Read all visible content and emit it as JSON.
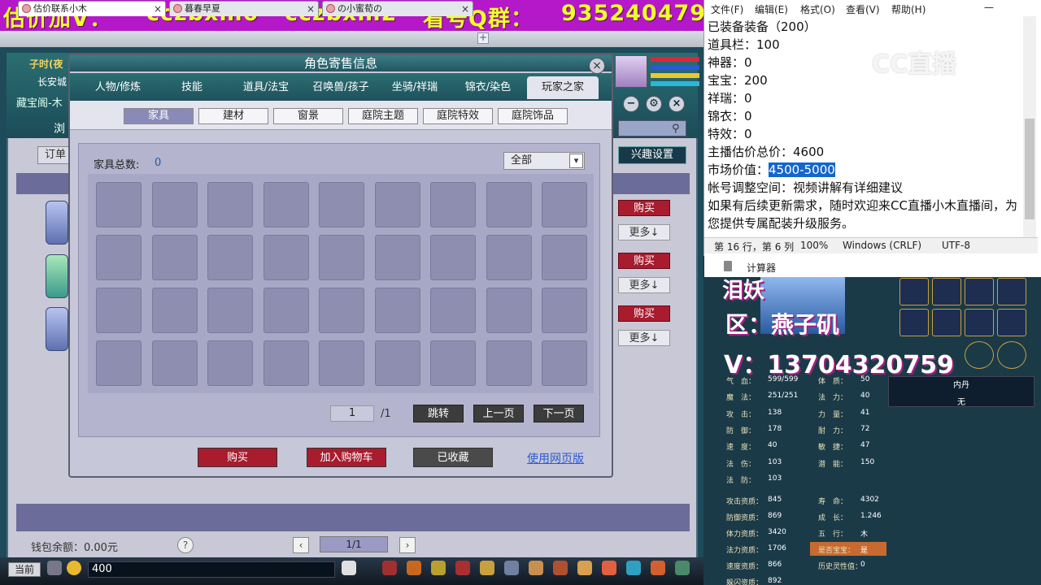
{
  "banner": {
    "a": "估价加V：",
    "b": "cczbxm0",
    "c": "cczbxm2",
    "d": "看号Q群：",
    "e": "935240479"
  },
  "browser_tabs": [
    "估价联系小木",
    "暮春早夏",
    "の小蜜荀の"
  ],
  "game": {
    "location_time": "子时(夜",
    "location_city": "长安城",
    "left_header": "藏宝阁-木",
    "left_browse": "浏",
    "order_label": "订单",
    "interest_button": "兴趣设置",
    "wallet": "钱包余额：0.00元",
    "help": "?",
    "page_indicator": "1/1",
    "chat_input": "400",
    "current_button": "当前",
    "outer_buy": "购买",
    "outer_more": "更多↓"
  },
  "dialog": {
    "title": "角色寄售信息",
    "close": "×",
    "tabs": [
      "人物/修炼",
      "技能",
      "道具/法宝",
      "召唤兽/孩子",
      "坐骑/祥瑞",
      "锦衣/染色",
      "玩家之家"
    ],
    "active_tab": 6,
    "subtabs": [
      "家具",
      "建材",
      "窗景",
      "庭院主题",
      "庭院特效",
      "庭院饰品"
    ],
    "active_subtab": 0,
    "count_label": "家具总数:",
    "count_value": "0",
    "filter": "全部",
    "page_input": "1",
    "page_total": "/1",
    "jump": "跳转",
    "prev": "上一页",
    "next": "下一页",
    "buy": "购买",
    "add_cart": "加入购物车",
    "favorited": "已收藏",
    "web_link": "使用网页版"
  },
  "notepad": {
    "menu": [
      "文件(F)",
      "编辑(E)",
      "格式(O)",
      "查看(V)",
      "帮助(H)"
    ],
    "lines": [
      "已装备装备（200）",
      "道具栏：100",
      "神器：0",
      "宝宝：200",
      "祥瑞：0",
      "锦衣：0",
      "特效：0",
      "主播估价总价：4600"
    ],
    "market_label": "市场价值：",
    "market_value": "4500-5000",
    "line_adjust": "帐号调整空间：视频讲解有详细建议",
    "line_more": "如果有后续更新需求，随时欢迎来CC直播小木直播间，为您提供专属配装升级服务。",
    "status": [
      "第 16 行，第 6 列",
      "100%",
      "Windows (CRLF)",
      "UTF-8"
    ],
    "watermark": "CC直播",
    "calc": "计算器"
  },
  "char_panel": {
    "name": "泪妖",
    "area": "区：燕子矶",
    "v": "V：13704320759",
    "neidan_label": "内丹",
    "neidan_value": "无",
    "stats_left": [
      [
        "气　血：",
        "599/599"
      ],
      [
        "魔　法：",
        "251/251"
      ],
      [
        "攻　击：",
        "138"
      ],
      [
        "防　御：",
        "178"
      ],
      [
        "速　度：",
        "40"
      ],
      [
        "法　伤：",
        "103"
      ],
      [
        "法　防：",
        "103"
      ]
    ],
    "stats_mid": [
      [
        "体　质：",
        "50"
      ],
      [
        "法　力：",
        "40"
      ],
      [
        "力　量：",
        "41"
      ],
      [
        "耐　力：",
        "72"
      ],
      [
        "敏　捷：",
        "47"
      ],
      [
        "潜　能：",
        "150"
      ]
    ],
    "apt_left": [
      [
        "攻击资质：",
        "845"
      ],
      [
        "防御资质：",
        "869"
      ],
      [
        "体力资质：",
        "3420"
      ],
      [
        "法力资质：",
        "1706"
      ],
      [
        "速度资质：",
        "866"
      ],
      [
        "躲闪资质：",
        "892"
      ]
    ],
    "apt_mid": [
      [
        "寿　命：",
        "4302"
      ],
      [
        "成　长：",
        "1.246"
      ],
      [
        "五　行：",
        "木"
      ],
      [
        "是否宝宝：",
        "是"
      ],
      [
        "历史灵性值：",
        "0"
      ]
    ]
  }
}
